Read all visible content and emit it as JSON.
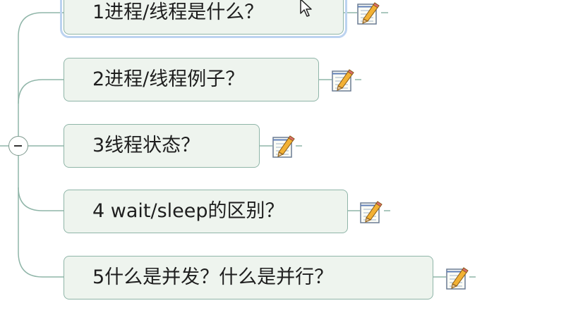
{
  "mindmap": {
    "topics": [
      {
        "label": "1进程/线程是什么？",
        "selected": true
      },
      {
        "label": "2进程/线程例子？",
        "selected": false
      },
      {
        "label": "3线程状态？",
        "selected": false
      },
      {
        "label": "4 wait/sleep的区别？",
        "selected": false
      },
      {
        "label": "5什么是并发？什么是并行？",
        "selected": false
      }
    ],
    "collapse_control": "minus-icon",
    "note_icon": "notepad-pencil-icon"
  },
  "colors": {
    "topic_fill": "#eef4ee",
    "topic_border": "#8fb5a8",
    "connector": "#8fb5a8",
    "selection": "#bcd3f0"
  }
}
